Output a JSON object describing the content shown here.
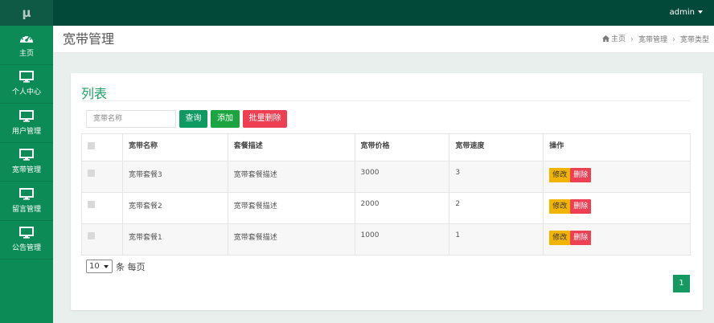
{
  "topbar": {
    "logo": "μ",
    "user": "admin"
  },
  "sidebar": {
    "items": [
      {
        "label": "主页",
        "icon": "dashboard-icon"
      },
      {
        "label": "个人中心",
        "icon": "monitor-icon"
      },
      {
        "label": "用户管理",
        "icon": "monitor-icon"
      },
      {
        "label": "宽带管理",
        "icon": "monitor-icon"
      },
      {
        "label": "留言管理",
        "icon": "monitor-icon"
      },
      {
        "label": "公告管理",
        "icon": "monitor-icon"
      }
    ]
  },
  "header": {
    "title": "宽带管理",
    "breadcrumb": [
      "主页",
      "宽带管理",
      "宽带类型"
    ]
  },
  "panel": {
    "title": "列表",
    "search_placeholder": "宽带名称",
    "buttons": {
      "query": "查询",
      "add": "添加",
      "batch_delete": "批量删除"
    }
  },
  "table": {
    "columns": [
      "宽带名称",
      "套餐描述",
      "宽带价格",
      "宽带速度",
      "操作"
    ],
    "rows": [
      {
        "name": "宽带套餐3",
        "desc": "宽带套餐描述",
        "price": "3000",
        "speed": "3"
      },
      {
        "name": "宽带套餐2",
        "desc": "宽带套餐描述",
        "price": "2000",
        "speed": "2"
      },
      {
        "name": "宽带套餐1",
        "desc": "宽带套餐描述",
        "price": "1000",
        "speed": "1"
      }
    ],
    "actions": {
      "edit": "修改",
      "delete": "删除"
    }
  },
  "pager": {
    "page_size": "10",
    "per_page_label": "条 每页",
    "current_page": "1"
  },
  "colors": {
    "accent": "#0d8b57",
    "topbar": "#02493a",
    "danger": "#ef3f52",
    "warning": "#f1b400"
  }
}
